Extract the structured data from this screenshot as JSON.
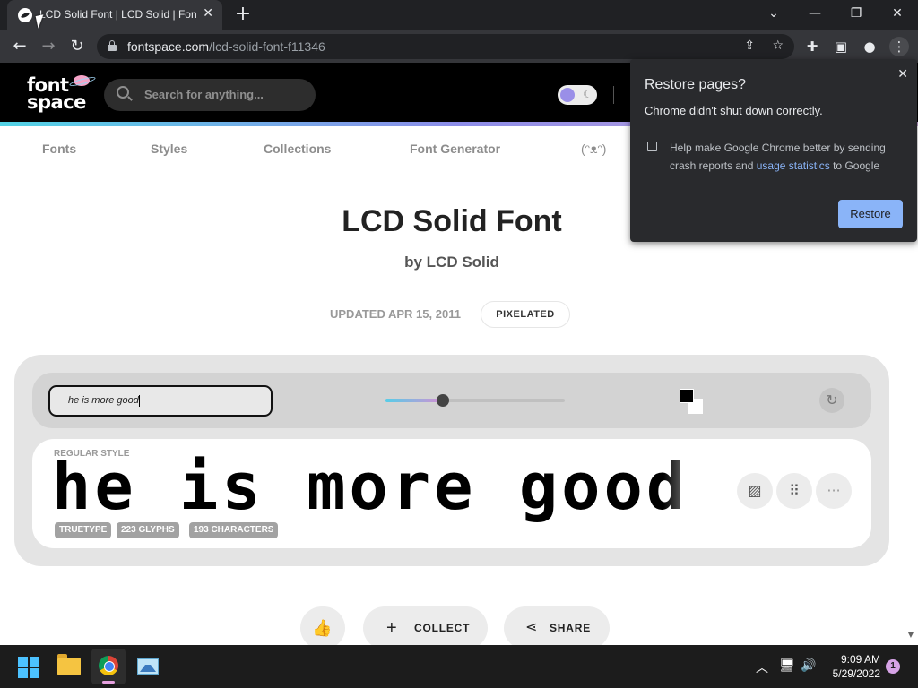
{
  "browser": {
    "tab_title": "LCD Solid Font | LCD Solid | FontSpace",
    "tab_close": "✕",
    "new_tab": "+",
    "url_host": "fontspace.com",
    "url_path": "/lcd-solid-font-f11346",
    "win_tabsearch": "⌄",
    "win_minimize": "—",
    "win_maximize": "❐",
    "win_close": "✕"
  },
  "site": {
    "logo_line1": "font",
    "logo_line2": "space",
    "search_placeholder": "Search for anything...",
    "nav": [
      "Fonts",
      "Styles",
      "Collections",
      "Font Generator",
      "(ᵔᴥᵔ)"
    ]
  },
  "font": {
    "title": "LCD Solid Font",
    "author": "by LCD Solid",
    "updated": "UPDATED APR 15, 2011",
    "tag": "PIXELATED"
  },
  "preview": {
    "input_value": "he is more good",
    "size_fraction": 0.32,
    "fg_color": "#000000",
    "bg_color": "#ffffff",
    "style_label": "REGULAR STYLE",
    "preview_text": "he is more good",
    "badges": [
      "TRUETYPE",
      "223 GLYPHS",
      "193 CHARACTERS"
    ]
  },
  "actions": {
    "like_icon": "thumbs-up-icon",
    "collect": "COLLECT",
    "share": "SHARE"
  },
  "popup": {
    "title": "Restore pages?",
    "message": "Chrome didn't shut down correctly.",
    "crash_text_before": "Help make Google Chrome better by sending crash reports and ",
    "crash_link": "usage statistics",
    "crash_text_after": " to Google",
    "restore_button": "Restore",
    "close": "✕"
  },
  "taskbar": {
    "time": "9:09 AM",
    "date": "5/29/2022",
    "notification_count": "1"
  },
  "colors": {
    "accent_blue": "#8ab4f8",
    "header_bg": "#000000",
    "restore_button": "#8ab4f8"
  }
}
